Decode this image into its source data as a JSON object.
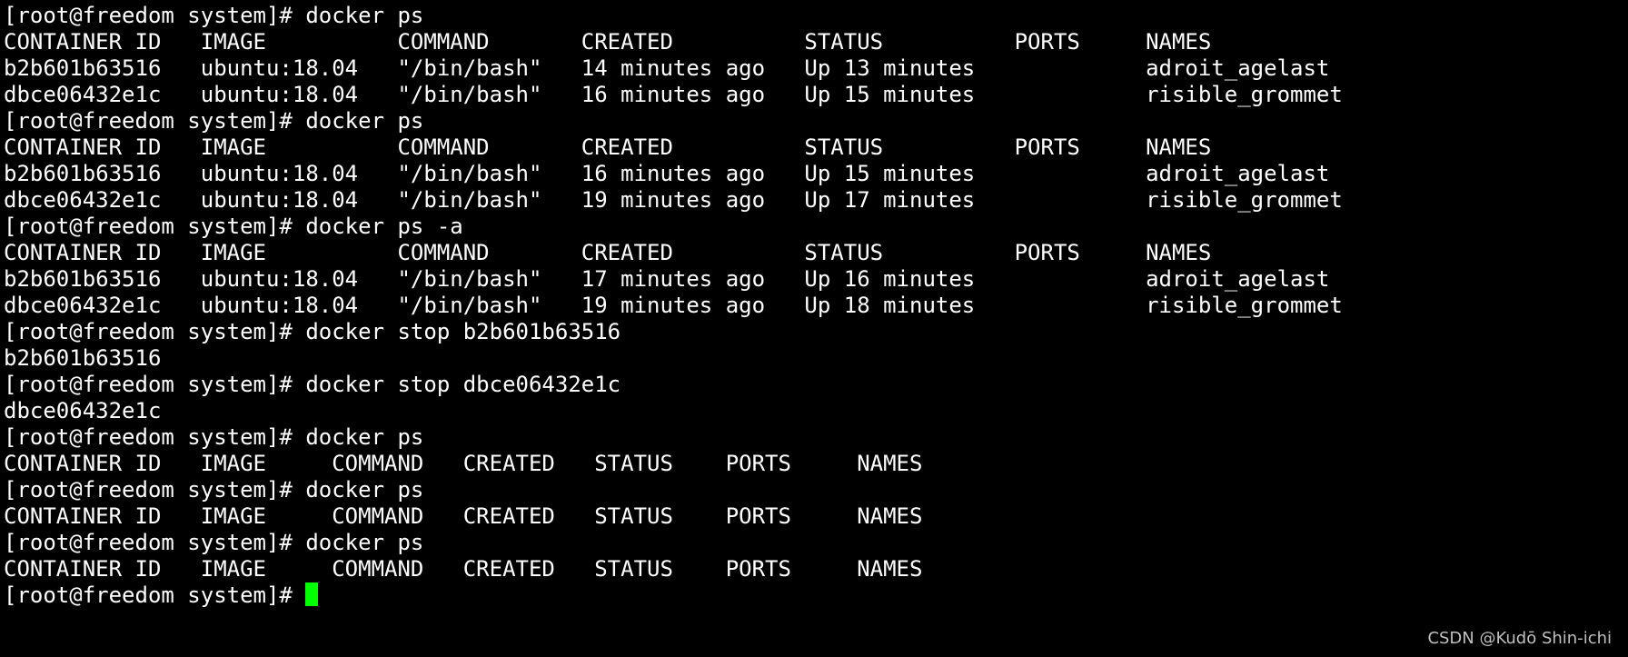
{
  "terminal": {
    "lines": [
      "[root@freedom system]# docker ps",
      "CONTAINER ID   IMAGE          COMMAND       CREATED          STATUS          PORTS     NAMES",
      "b2b601b63516   ubuntu:18.04   \"/bin/bash\"   14 minutes ago   Up 13 minutes             adroit_agelast",
      "dbce06432e1c   ubuntu:18.04   \"/bin/bash\"   16 minutes ago   Up 15 minutes             risible_grommet",
      "[root@freedom system]# docker ps",
      "CONTAINER ID   IMAGE          COMMAND       CREATED          STATUS          PORTS     NAMES",
      "b2b601b63516   ubuntu:18.04   \"/bin/bash\"   16 minutes ago   Up 15 minutes             adroit_agelast",
      "dbce06432e1c   ubuntu:18.04   \"/bin/bash\"   19 minutes ago   Up 17 minutes             risible_grommet",
      "[root@freedom system]# docker ps -a",
      "CONTAINER ID   IMAGE          COMMAND       CREATED          STATUS          PORTS     NAMES",
      "b2b601b63516   ubuntu:18.04   \"/bin/bash\"   17 minutes ago   Up 16 minutes             adroit_agelast",
      "dbce06432e1c   ubuntu:18.04   \"/bin/bash\"   19 minutes ago   Up 18 minutes             risible_grommet",
      "[root@freedom system]# docker stop b2b601b63516",
      "b2b601b63516",
      "[root@freedom system]# docker stop dbce06432e1c",
      "dbce06432e1c",
      "[root@freedom system]# docker ps",
      "CONTAINER ID   IMAGE     COMMAND   CREATED   STATUS    PORTS     NAMES",
      "[root@freedom system]# docker ps",
      "CONTAINER ID   IMAGE     COMMAND   CREATED   STATUS    PORTS     NAMES",
      "[root@freedom system]# docker ps",
      "CONTAINER ID   IMAGE     COMMAND   CREATED   STATUS    PORTS     NAMES"
    ],
    "prompt": "[root@freedom system]# "
  },
  "watermark": "CSDN @Kudō Shin-ichi",
  "colors": {
    "background": "#000000",
    "text": "#ffffff",
    "cursor": "#00ff00"
  }
}
